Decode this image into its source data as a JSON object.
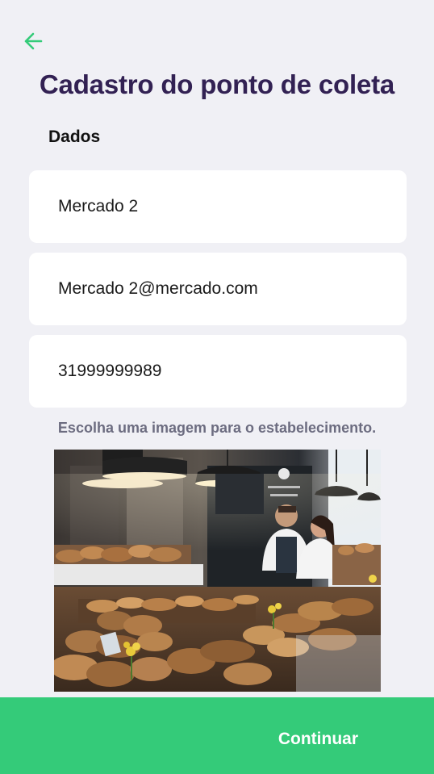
{
  "header": {
    "back_icon": "arrow-left-icon",
    "title": "Cadastro do ponto de coleta"
  },
  "form": {
    "section_title": "Dados",
    "name_value": "Mercado 2",
    "email_value": "Mercado 2@mercado.com",
    "phone_value": "31999999989"
  },
  "image_picker": {
    "hint": "Escolha uma imagem para o estabelecimento."
  },
  "footer": {
    "continue_label": "Continuar"
  },
  "colors": {
    "accent": "#34cb79",
    "title": "#322153",
    "background": "#f0f0f5",
    "muted_text": "#6c6c80"
  }
}
